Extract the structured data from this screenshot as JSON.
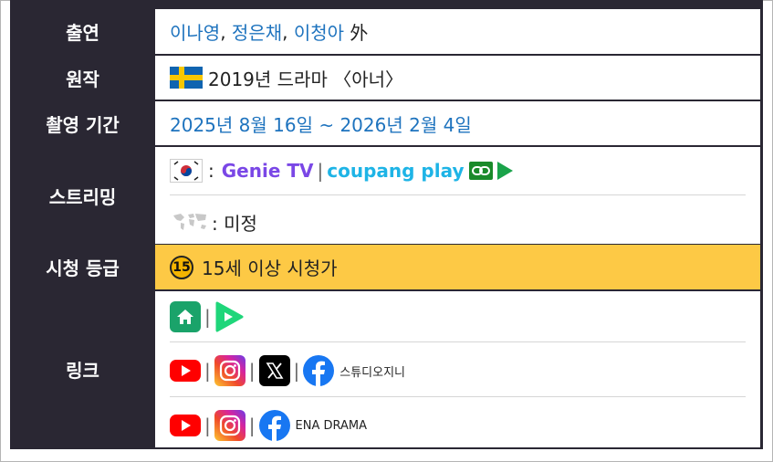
{
  "rows": {
    "cast": {
      "label": "출연",
      "names": [
        "이나영",
        "정은채",
        "이청아"
      ],
      "sep": ",",
      "suffix": "外"
    },
    "original": {
      "label": "원작",
      "text": "2019년 드라마 〈아너〉",
      "flag_icon": "sweden-flag-icon"
    },
    "filming": {
      "label": "촬영 기간",
      "text": "2025년 8월 16일 ~ 2026년 2월 4일"
    },
    "streaming": {
      "label": "스트리밍",
      "kr_colon": ":",
      "genie": "Genie TV",
      "pipe": "|",
      "coupang": "coupang play",
      "world_text": ": 미정"
    },
    "rating": {
      "label": "시청 등급",
      "badge": "15",
      "text": "15세 이상 시청가",
      "bg": "#fdc945"
    },
    "links": {
      "label": "링크",
      "pipe": "|",
      "studio_name": "스튜디오지니",
      "ena_name": "ENA DRAMA"
    }
  },
  "colors": {
    "header_bg": "#2a2733",
    "link_blue": "#1e73be",
    "genie_purple": "#7a47e6",
    "coupang_blue": "#1eb4e6",
    "green": "#1aa34a"
  }
}
